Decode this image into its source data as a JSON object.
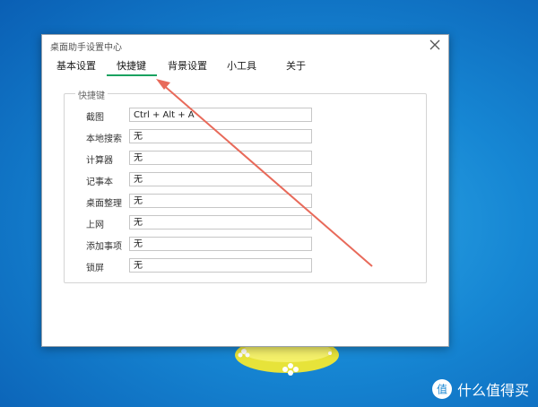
{
  "window": {
    "title": "桌面助手设置中心"
  },
  "tabs": [
    {
      "label": "基本设置"
    },
    {
      "label": "快捷键"
    },
    {
      "label": "背景设置"
    },
    {
      "label": "小工具"
    },
    {
      "label": "关于"
    }
  ],
  "active_tab": "快捷键",
  "shortcuts": {
    "group_title": "快捷键",
    "rows": [
      {
        "label": "截图",
        "value": "Ctrl + Alt + A"
      },
      {
        "label": "本地搜索",
        "value": "无"
      },
      {
        "label": "计算器",
        "value": "无"
      },
      {
        "label": "记事本",
        "value": "无"
      },
      {
        "label": "桌面整理",
        "value": "无"
      },
      {
        "label": "上网",
        "value": "无"
      },
      {
        "label": "添加事项",
        "value": "无"
      },
      {
        "label": "锁屏",
        "value": "无"
      }
    ]
  },
  "watermark": {
    "text": "什么值得买"
  },
  "colors": {
    "active_tab_underline": "#1aa260",
    "annotation_arrow": "#e86a5a"
  }
}
